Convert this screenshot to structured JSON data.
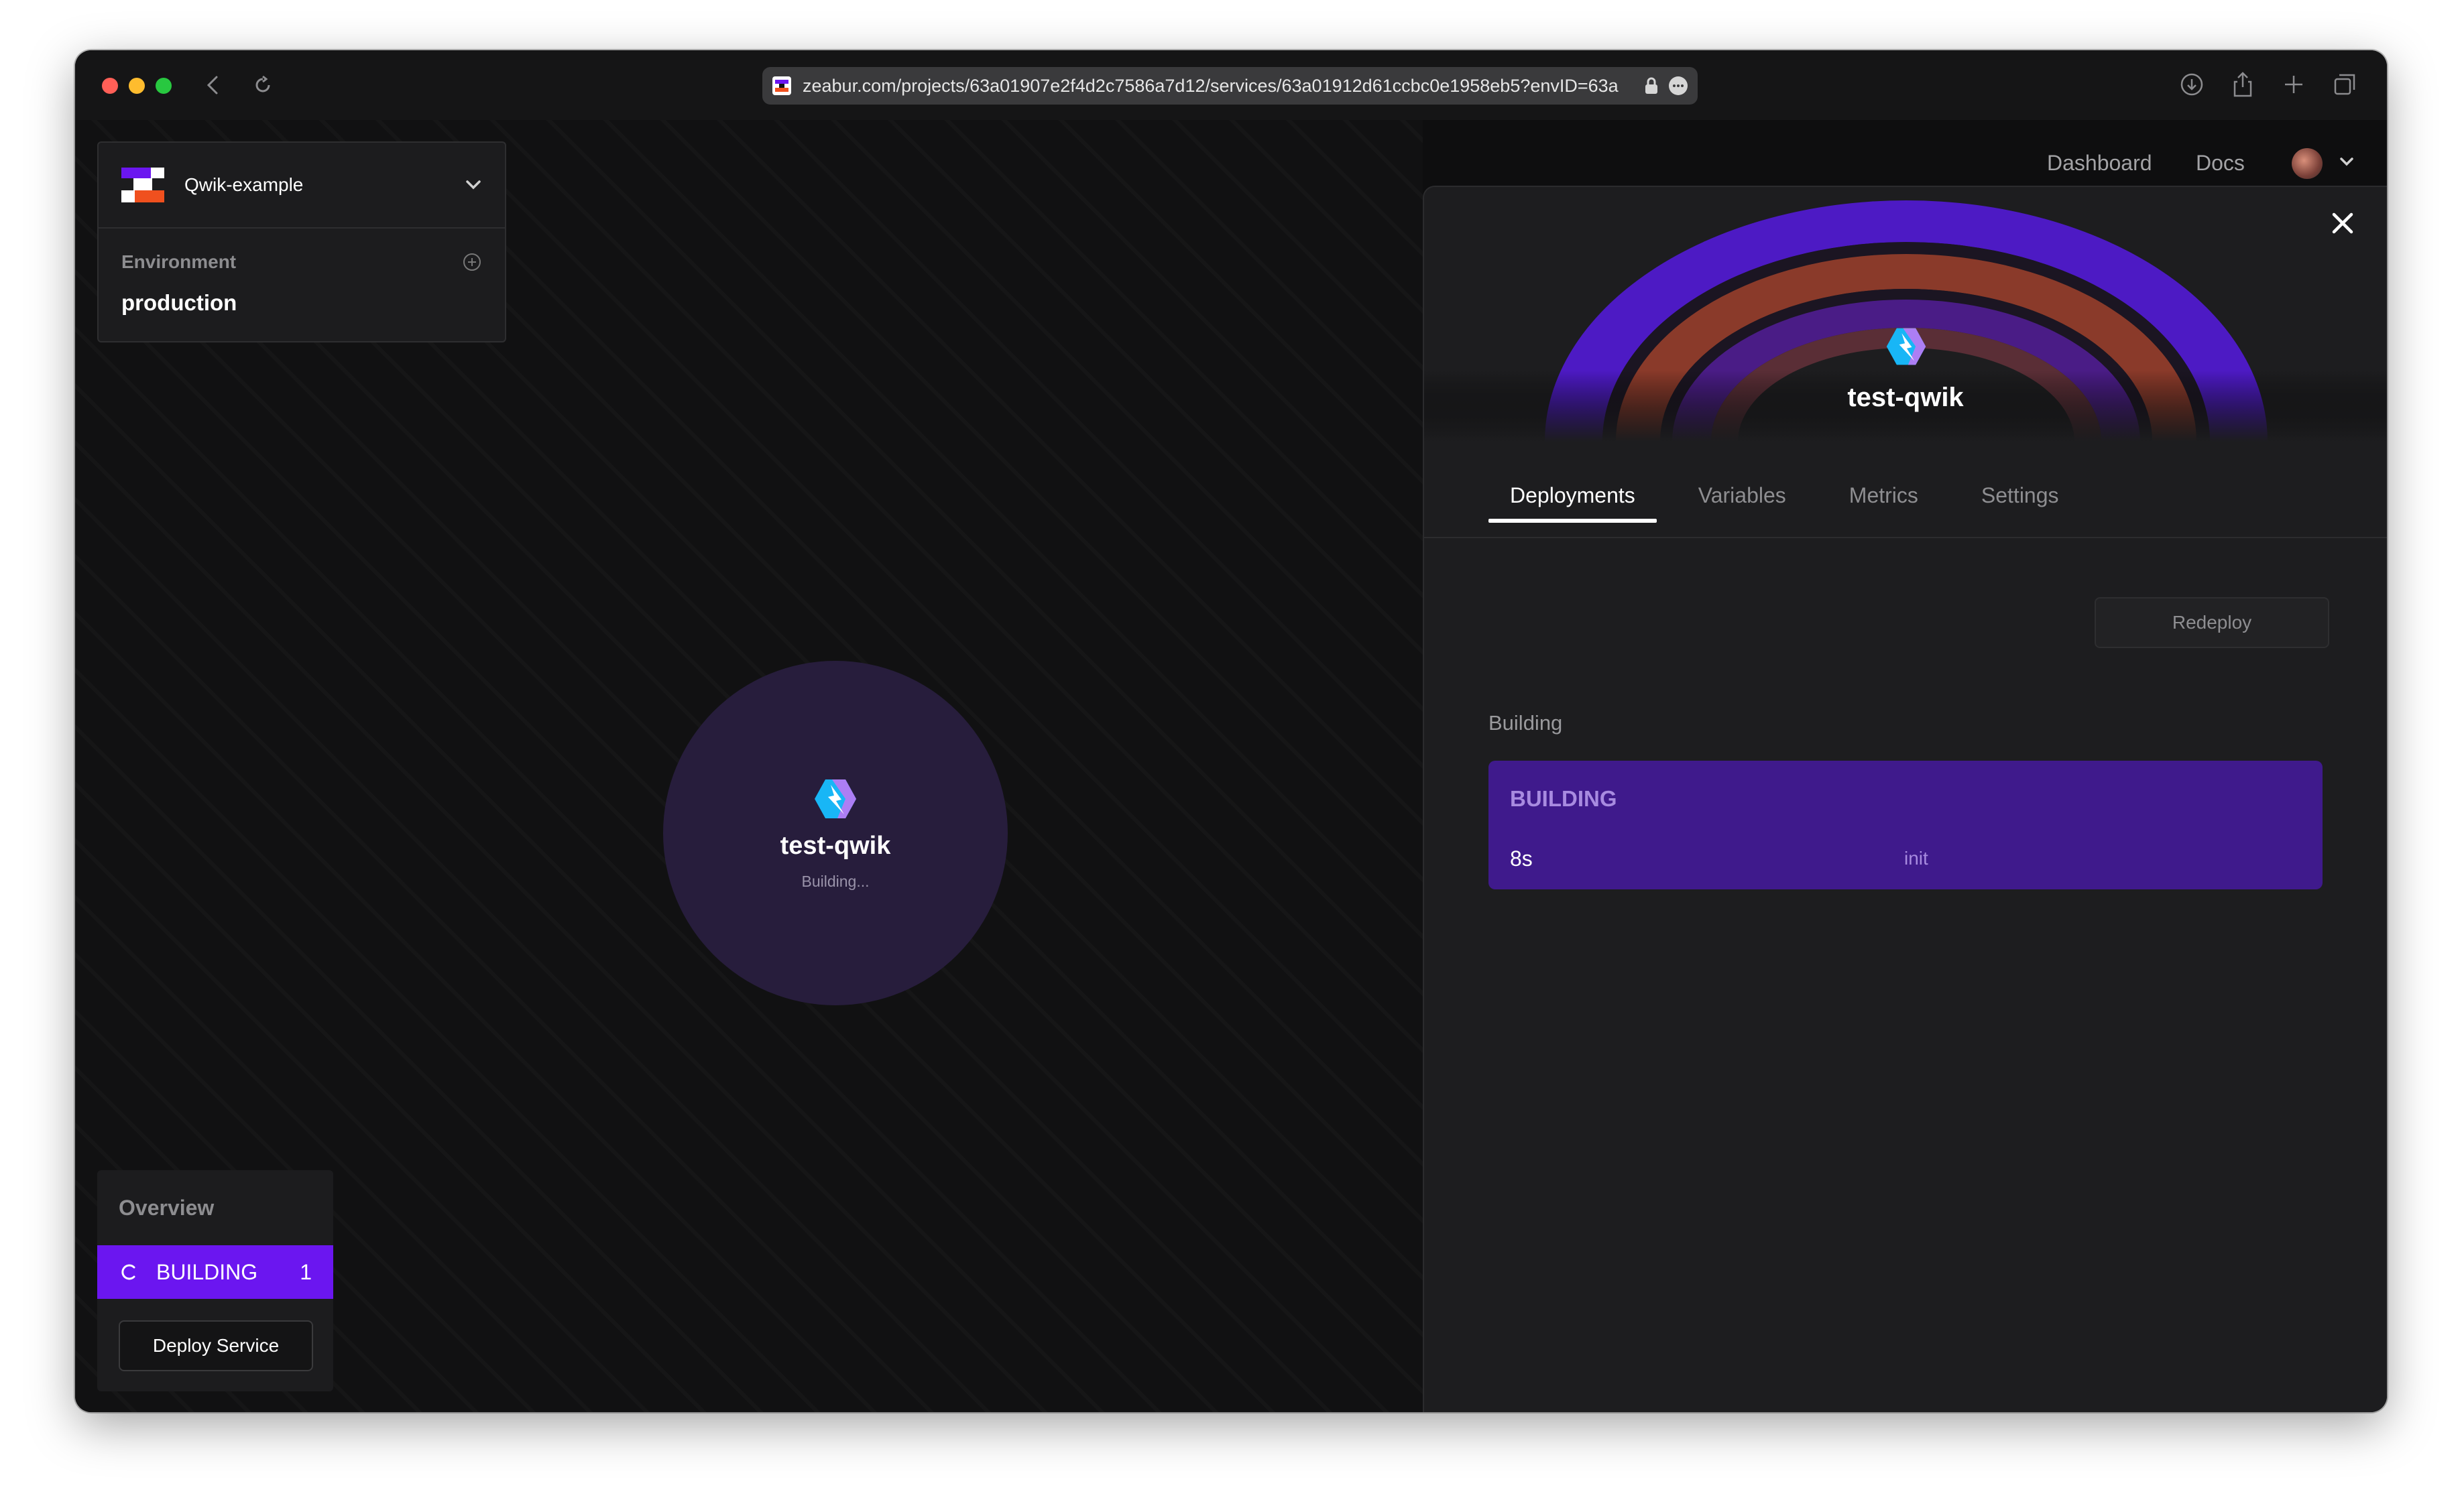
{
  "browser": {
    "url": "zeabur.com/projects/63a01907e2f4d2c7586a7d12/services/63a01912d61ccbc0e1958eb5?envID=63a"
  },
  "project": {
    "name": "Qwik-example",
    "environment_label": "Environment",
    "environment_value": "production"
  },
  "service_node": {
    "name": "test-qwik",
    "status": "Building..."
  },
  "overview": {
    "title": "Overview",
    "status_label": "BUILDING",
    "status_count": "1",
    "deploy_button": "Deploy Service"
  },
  "topnav": {
    "dashboard": "Dashboard",
    "docs": "Docs"
  },
  "panel": {
    "service_name": "test-qwik",
    "tabs": [
      {
        "label": "Deployments",
        "active": true
      },
      {
        "label": "Variables",
        "active": false
      },
      {
        "label": "Metrics",
        "active": false
      },
      {
        "label": "Settings",
        "active": false
      }
    ],
    "redeploy_button": "Redeploy",
    "section_label": "Building",
    "deployment": {
      "status": "BUILDING",
      "duration": "8s",
      "stage": "init"
    }
  },
  "colors": {
    "accent_purple": "#6b16f0",
    "card_purple": "#3f1a8c",
    "node_bg": "#271d3c"
  }
}
